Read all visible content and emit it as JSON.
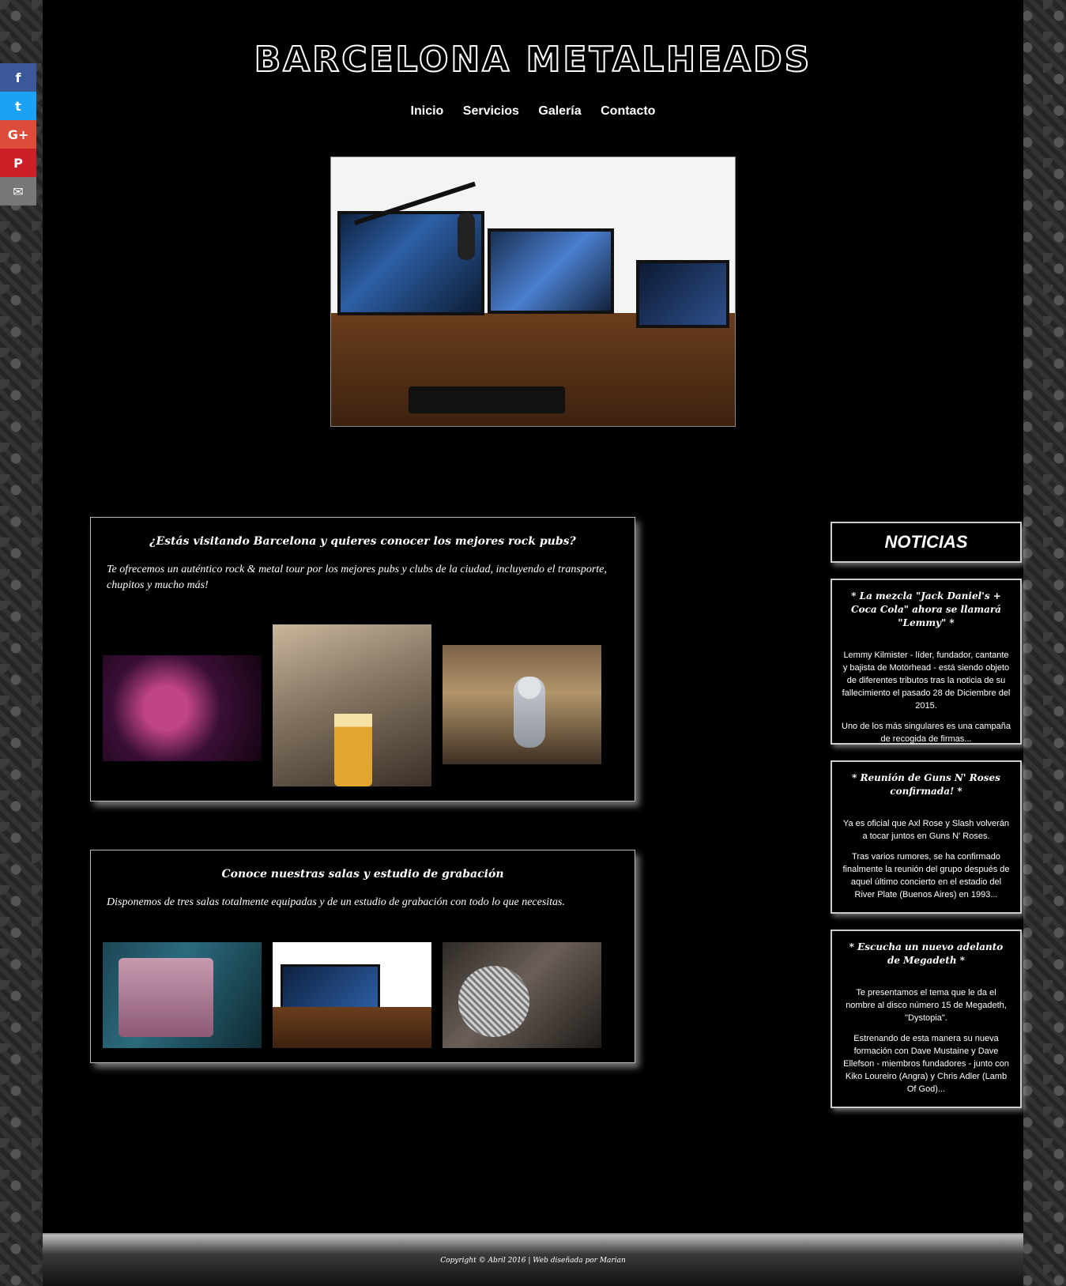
{
  "share": [
    {
      "icon": "facebook-icon",
      "glyph": "f",
      "color": "#3b5998"
    },
    {
      "icon": "twitter-icon",
      "glyph": "t",
      "color": "#1da1f2"
    },
    {
      "icon": "google-plus-icon",
      "glyph": "G+",
      "color": "#dd4b39"
    },
    {
      "icon": "pinterest-icon",
      "glyph": "P",
      "color": "#cb2027"
    },
    {
      "icon": "email-icon",
      "glyph": "✉",
      "color": "#777777"
    }
  ],
  "header": {
    "logo": "BARCELONA METALHEADS",
    "nav": [
      "Inicio",
      "Servicios",
      "Galería",
      "Contacto"
    ]
  },
  "section1": {
    "title": "¿Estás visitando Barcelona y quieres conocer los mejores rock pubs?",
    "text": "Te ofrecemos un auténtico rock & metal tour por los mejores pubs y clubs de la ciudad, incluyendo el transporte, chupitos y mucho más!"
  },
  "section2": {
    "title": "Conoce nuestras salas y estudio de grabación",
    "text": "Disponemos de tres salas totalmente equipadas y de un estudio de grabación con todo lo que necesitas."
  },
  "sidebar": {
    "title": "NOTICIAS",
    "news": [
      {
        "title": "* La mezcla \"Jack Daniel's + Coca Cola\" ahora se llamará \"Lemmy\" *",
        "p1": "Lemmy Kilmister - líder, fundador, cantante y bajista de Motörhead - está siendo objeto de diferentes tributos tras la noticia de su fallecimiento el pasado 28 de Diciembre del 2015.",
        "p2": "Uno de los más singulares es una campaña de recogida de firmas..."
      },
      {
        "title": "* Reunión de Guns N' Roses confirmada! *",
        "p1": "Ya es oficial que Axl Rose y Slash volverán a tocar juntos en Guns N' Roses.",
        "p2": "Tras varios rumores, se ha confirmado finalmente la reunión del grupo después de aquel último concierto en el estadio del River Plate (Buenos Aires) en 1993..."
      },
      {
        "title": "* Escucha un nuevo adelanto de Megadeth *",
        "p1": "Te presentamos el tema que le da el nombre al disco número 15 de Megadeth, \"Dystopia\".",
        "p2": "Estrenando de esta manera su nueva formación con Dave Mustaine y Dave Ellefson - miembros fundadores - junto con Kiko Loureiro (Angra) y Chris Adler (Lamb Of God)..."
      }
    ]
  },
  "footer": {
    "text": "Copyright © Abril 2016 | Web diseñada por Marian"
  }
}
